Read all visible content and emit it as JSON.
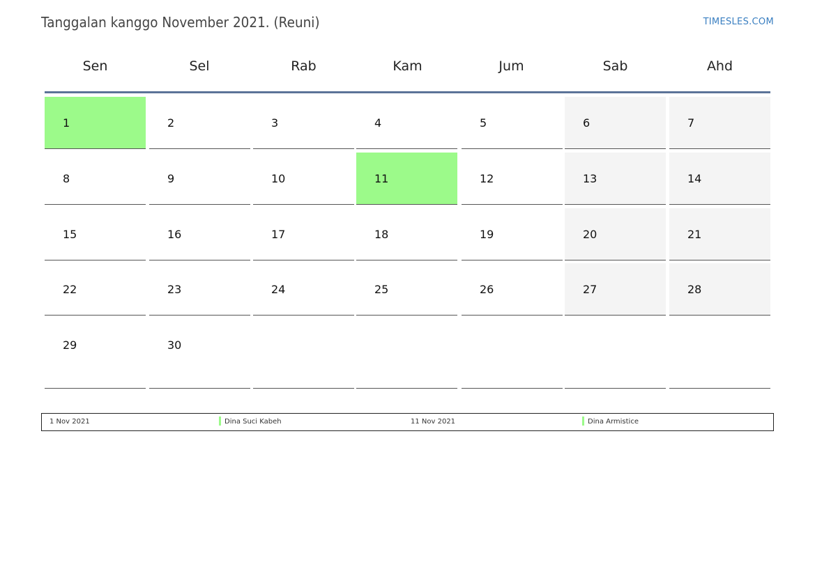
{
  "header": {
    "title": "Tanggalan kanggo November 2021. (Reuni)",
    "brand": "TIMESLES.COM"
  },
  "weekdays": [
    "Sen",
    "Sel",
    "Rab",
    "Kam",
    "Jum",
    "Sab",
    "Ahd"
  ],
  "calendar": {
    "weeks": [
      [
        "1",
        "2",
        "3",
        "4",
        "5",
        "6",
        "7"
      ],
      [
        "8",
        "9",
        "10",
        "11",
        "12",
        "13",
        "14"
      ],
      [
        "15",
        "16",
        "17",
        "18",
        "19",
        "20",
        "21"
      ],
      [
        "22",
        "23",
        "24",
        "25",
        "26",
        "27",
        "28"
      ],
      [
        "29",
        "30",
        "",
        "",
        "",
        "",
        ""
      ]
    ],
    "holidays": [
      "1",
      "11"
    ],
    "weekend_columns": [
      5,
      6
    ]
  },
  "legend": {
    "items": [
      {
        "date": "1 Nov 2021",
        "name": "Dina Suci Kabeh"
      },
      {
        "date": "11 Nov 2021",
        "name": "Dina Armistice"
      }
    ]
  },
  "colors": {
    "holiday": "#9cfa8a",
    "weekend": "#f4f4f4",
    "header_rule": "#5b7398",
    "brand": "#3a7fc1"
  }
}
